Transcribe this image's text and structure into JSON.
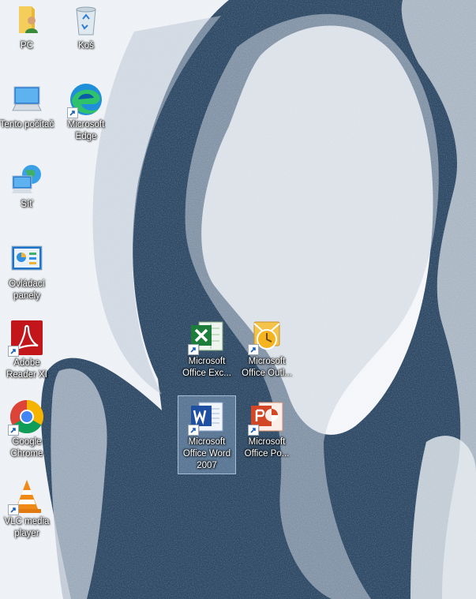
{
  "desktop": {
    "icons": [
      {
        "label": "PC",
        "icon": "user-folder-icon"
      },
      {
        "label": "Koš",
        "icon": "recycle-bin-icon"
      },
      {
        "label": "Tento počítač",
        "icon": "computer-icon"
      },
      {
        "label": "Microsoft Edge",
        "icon": "edge-icon"
      },
      {
        "label": "Síť",
        "icon": "network-icon"
      },
      {
        "label": "Ovládací panely",
        "icon": "control-panel-icon"
      },
      {
        "label": "Adobe Reader XI",
        "icon": "adobe-reader-icon"
      },
      {
        "label": "Google Chrome",
        "icon": "chrome-icon"
      },
      {
        "label": "VLC media player",
        "icon": "vlc-icon"
      },
      {
        "label": "Microsoft Office Exc...",
        "icon": "excel-icon"
      },
      {
        "label": "Microsoft Office Outl...",
        "icon": "outlook-icon"
      },
      {
        "label": "Microsoft Office Word 2007",
        "icon": "word-icon"
      },
      {
        "label": "Microsoft Office Po...",
        "icon": "powerpoint-icon"
      }
    ]
  },
  "colors": {
    "wallpaper_dark": "#2f4a66",
    "wallpaper_light": "#eef1f5",
    "selection": "#aac8eb"
  }
}
